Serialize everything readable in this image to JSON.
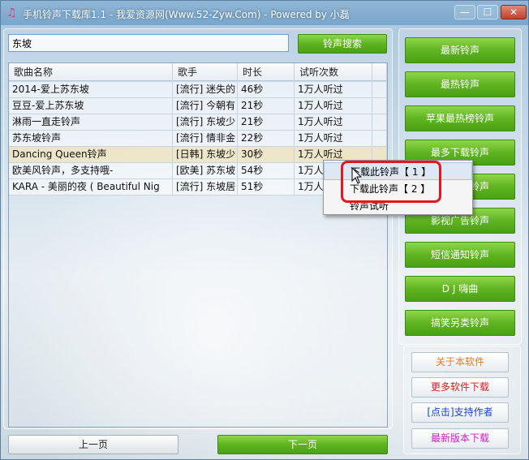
{
  "window": {
    "title": "手机铃声下载库1.1 - 我爱资源网(Www.52-Zyw.Com) - Powered by 小磊",
    "min_label": "—",
    "max_label": "☐",
    "close_label": "✕"
  },
  "search": {
    "value": "东坡",
    "button_label": "铃声搜索"
  },
  "table": {
    "columns": [
      "歌曲名称",
      "歌手",
      "时长",
      "试听次数"
    ],
    "rows": [
      {
        "name": "2014-爱上苏东坡",
        "artist": "[流行] 迷失的",
        "duration": "46秒",
        "plays": "1万人听过"
      },
      {
        "name": "豆豆-爱上苏东坡",
        "artist": "[流行] 今朝有",
        "duration": "21秒",
        "plays": "1万人听过"
      },
      {
        "name": "淋雨一直走铃声",
        "artist": "[流行] 东坡少",
        "duration": "21秒",
        "plays": "1万人听过"
      },
      {
        "name": "苏东坡铃声",
        "artist": "[流行] 情非金",
        "duration": "22秒",
        "plays": "1万人听过"
      },
      {
        "name": "Dancing Queen铃声",
        "artist": "[日韩] 东坡少",
        "duration": "30秒",
        "plays": "1万人听过"
      },
      {
        "name": "欧美风铃声，多支持哦-",
        "artist": "[欧美] 苏东坡",
        "duration": "54秒",
        "plays": "1万人"
      },
      {
        "name": "KARA - 美丽的夜 ( Beautiful Nig",
        "artist": "[流行] 东坡居",
        "duration": "51秒",
        "plays": "1万人"
      }
    ]
  },
  "pagination": {
    "prev_label": "上一页",
    "next_label": "下一页"
  },
  "categories": [
    "最新铃声",
    "最热铃声",
    "苹果最热榜铃声",
    "最多下载铃声",
    "经典老歌铃声",
    "影视广告铃声",
    "短信通知铃声",
    "D J 嗨曲",
    "搞笑另类铃声"
  ],
  "extra_links": [
    {
      "label": "关于本软件",
      "color": "#e87a1e"
    },
    {
      "label": "更多软件下载",
      "color": "#d42020"
    },
    {
      "label": "[点击]支持作者",
      "color": "#1a3fd0"
    },
    {
      "label": "最新版本下载",
      "color": "#d020c0"
    }
  ],
  "context_menu": {
    "items": [
      "下载此铃声【 1 】",
      "下载此铃声【 2 】",
      "铃声试听"
    ]
  },
  "colors": {
    "accent_green": "#5fb420",
    "highlight_red": "#e0181f"
  }
}
